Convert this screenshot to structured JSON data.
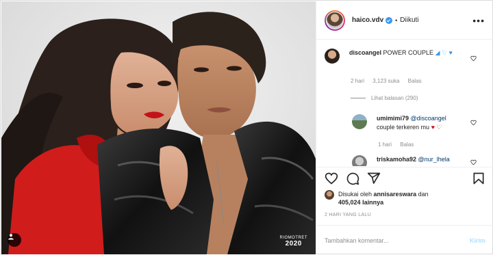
{
  "header": {
    "username": "haico.vdv",
    "separator": "•",
    "follow_status": "Diikuti",
    "more_icon": "more-horizontal-icon"
  },
  "photo": {
    "watermark_line1": "RIOMOTRET",
    "watermark_line2": "2020"
  },
  "comments": [
    {
      "user": "discoangel",
      "text": "POWER COUPLE",
      "emojis": "◢ ♡ ♥",
      "time": "2 hari",
      "likes": "3,123 suka",
      "reply": "Balas",
      "view_replies": "Lihat balasan (290)"
    },
    {
      "user": "umimimi79",
      "mention": "@discoangel",
      "text": "couple terkeren mu",
      "emojis": "♥ ♡",
      "time": "1 hari",
      "reply": "Balas"
    },
    {
      "user": "triskamoha92",
      "mention": "@nur_lhela"
    }
  ],
  "actions": {
    "like_icon": "heart-icon",
    "comment_icon": "comment-icon",
    "share_icon": "share-icon",
    "save_icon": "bookmark-icon"
  },
  "likes": {
    "prefix": "Disukai oleh",
    "user": "annisareswara",
    "and": "dan",
    "count": "405,024",
    "suffix": "lainnya"
  },
  "timestamp": "2 HARI YANG LALU",
  "add_comment": {
    "placeholder": "Tambahkan komentar...",
    "post_label": "Kirim"
  },
  "colors": {
    "accent_link": "#00376b",
    "verified": "#3897f0",
    "post_disabled": "#b2dffc"
  }
}
